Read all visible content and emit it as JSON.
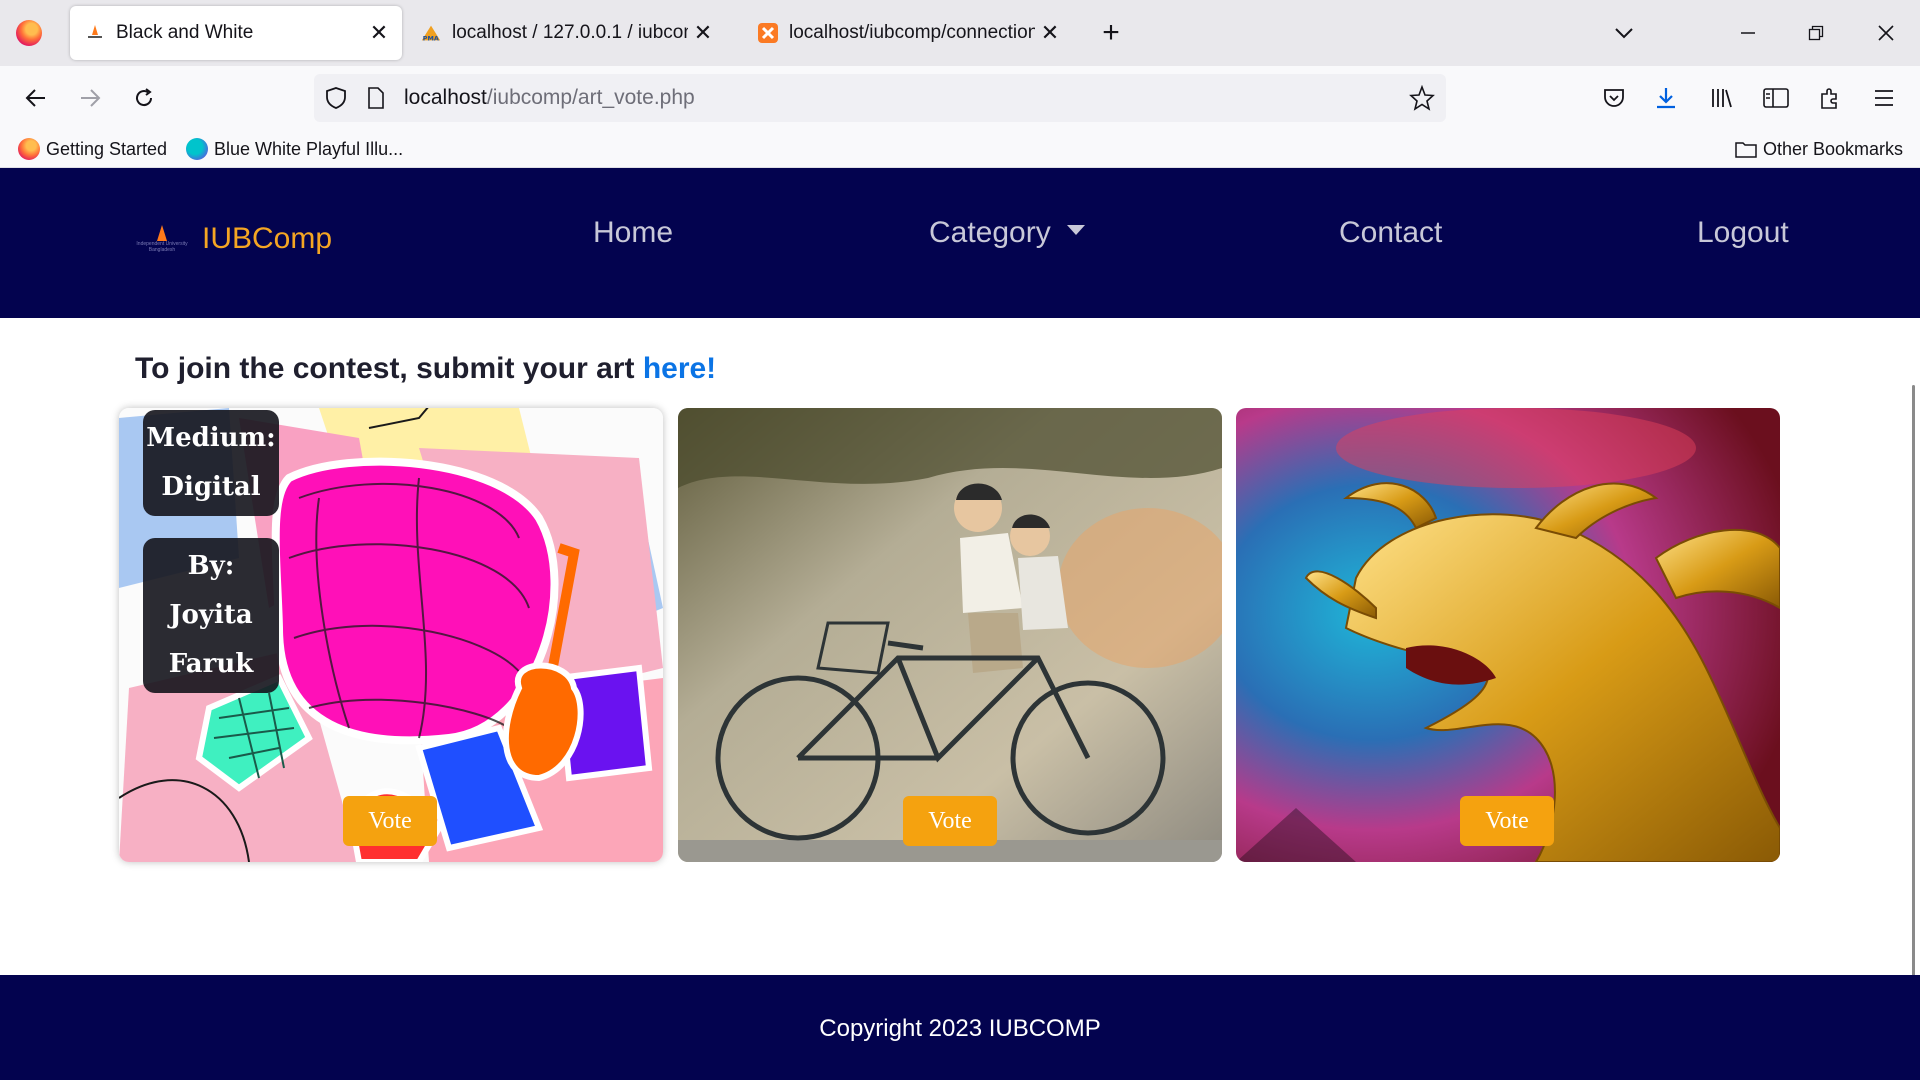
{
  "browser": {
    "tabs": [
      {
        "title": "Black and White",
        "active": true,
        "icon": "iub-favicon"
      },
      {
        "title": "localhost / 127.0.0.1 / iubcomp",
        "active": false,
        "icon": "phpmyadmin-icon"
      },
      {
        "title": "localhost/iubcomp/connection.p",
        "active": false,
        "icon": "xampp-icon"
      }
    ],
    "url_host": "localhost",
    "url_path": "/iubcomp/art_vote.php",
    "bookmarks": [
      {
        "label": "Getting Started",
        "icon": "firefox-icon"
      },
      {
        "label": "Blue White Playful Illu...",
        "icon": "canva-icon"
      }
    ],
    "other_bookmarks": "Other Bookmarks"
  },
  "site": {
    "brand": "IUBComp",
    "logo_text": "Independent University Bangladesh",
    "nav": {
      "home": "Home",
      "category": "Category",
      "contact": "Contact",
      "logout": "Logout"
    },
    "intro_text": "To join the contest, submit your art ",
    "intro_link": "here!",
    "cards": [
      {
        "medium": "Medium: Digital",
        "by": "By: Joyita Faruk",
        "vote": "Vote",
        "art": "colorful-digital-collage"
      },
      {
        "vote": "Vote",
        "art": "street-mural-kids-on-bicycle"
      },
      {
        "vote": "Vote",
        "art": "golden-dragon-statue"
      }
    ],
    "footer": "Copyright 2023 IUBCOMP"
  },
  "colors": {
    "header_bg": "#03034f",
    "brand": "#f5a623",
    "vote_button": "#f5a20f",
    "link": "#0b74e5"
  }
}
